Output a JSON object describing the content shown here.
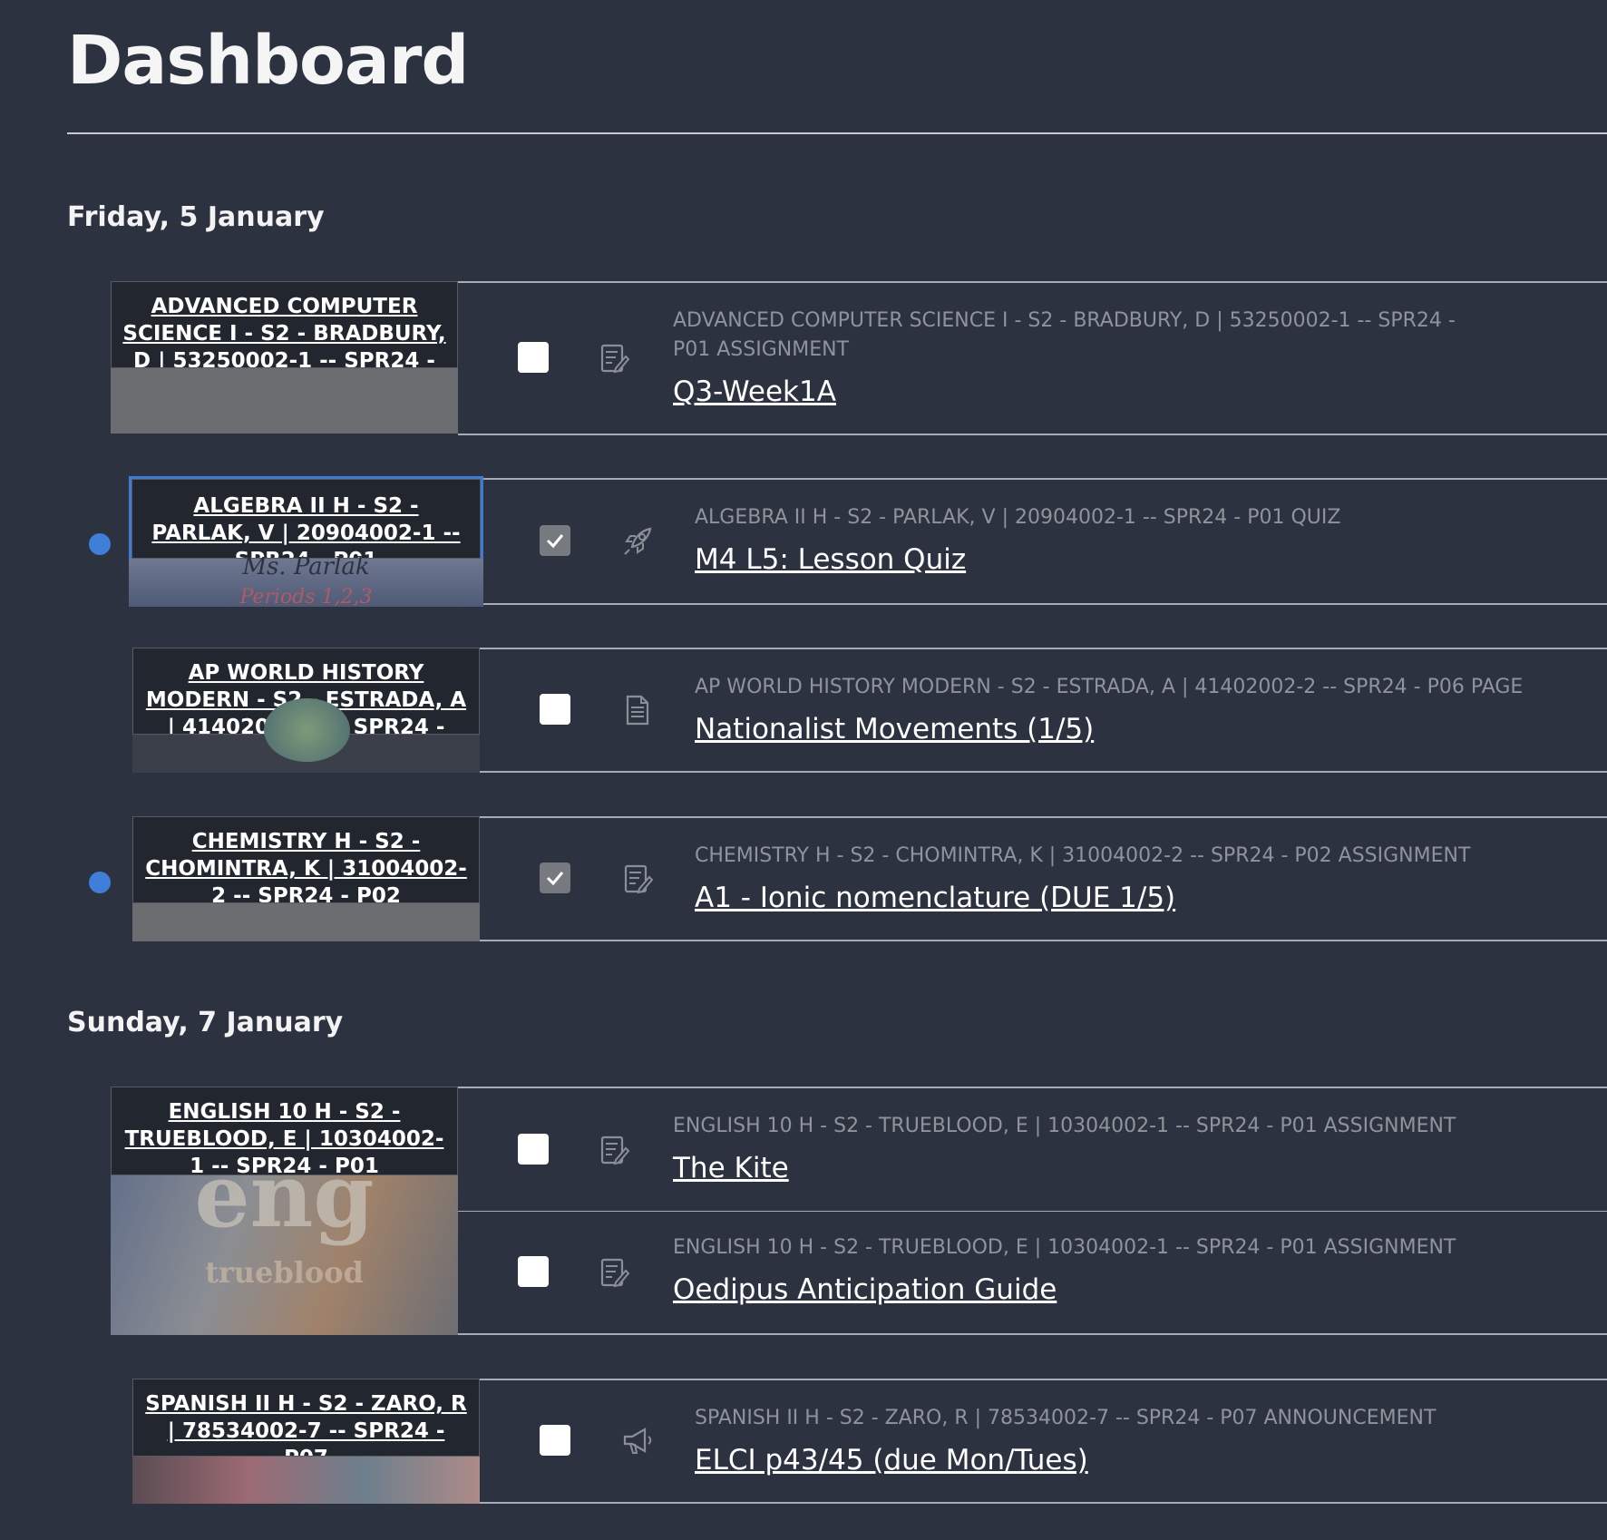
{
  "page": {
    "title": "Dashboard"
  },
  "days": [
    {
      "label": "Friday, 5 January",
      "groups": [
        {
          "course": "ADVANCED COMPUTER SCIENCE I - S2 - BRADBURY, D | 53250002-1 -- SPR24 - P01",
          "items": [
            {
              "meta": "ADVANCED COMPUTER SCIENCE I - S2 - BRADBURY, D | 53250002-1 -- SPR24 - P01 ASSIGNMENT",
              "title": "Q3-Week1A",
              "completed": false,
              "icon": "assignment-icon",
              "new": false
            }
          ]
        },
        {
          "course": "ALGEBRA II H - S2 - PARLAK, V | 20904002-1 -- SPR24 - P01",
          "image_text": [
            "Ms. Parlak",
            "Periods 1,2,3"
          ],
          "items": [
            {
              "meta": "ALGEBRA II H - S2 - PARLAK, V | 20904002-1 -- SPR24 - P01 QUIZ",
              "title": "M4 L5: Lesson Quiz",
              "completed": true,
              "icon": "quiz-rocket-icon",
              "new": true
            }
          ]
        },
        {
          "course": "AP WORLD HISTORY MODERN - S2 - ESTRADA, A | 41402002-2 -- SPR24 - P06",
          "items": [
            {
              "meta": "AP WORLD HISTORY MODERN - S2 - ESTRADA, A | 41402002-2 -- SPR24 - P06 PAGE",
              "title": "Nationalist Movements (1/5)",
              "completed": false,
              "icon": "page-icon",
              "new": false
            }
          ]
        },
        {
          "course": "CHEMISTRY H - S2 - CHOMINTRA, K | 31004002-2 -- SPR24 - P02",
          "items": [
            {
              "meta": "CHEMISTRY H - S2 - CHOMINTRA, K | 31004002-2 -- SPR24 - P02 ASSIGNMENT",
              "title": "A1 - Ionic nomenclature (DUE 1/5)",
              "completed": true,
              "icon": "assignment-icon",
              "new": true
            }
          ]
        }
      ]
    },
    {
      "label": "Sunday, 7 January",
      "groups": [
        {
          "course": "ENGLISH 10 H - S2 - TRUEBLOOD, E | 10304002-1 -- SPR24 - P01",
          "image_text": [
            "eng",
            "trueblood"
          ],
          "items": [
            {
              "meta": "ENGLISH 10 H - S2 - TRUEBLOOD, E | 10304002-1 -- SPR24 - P01 ASSIGNMENT",
              "title": "The Kite",
              "completed": false,
              "icon": "assignment-icon",
              "new": false
            },
            {
              "meta": "ENGLISH 10 H - S2 - TRUEBLOOD, E | 10304002-1 -- SPR24 - P01 ASSIGNMENT",
              "title": "Oedipus Anticipation Guide",
              "completed": false,
              "icon": "assignment-icon",
              "new": false
            }
          ]
        },
        {
          "course": "SPANISH II H - S2 - ZARO, R | 78534002-7 -- SPR24 - P07",
          "items": [
            {
              "meta": "SPANISH II H - S2 - ZARO, R | 78534002-7 -- SPR24 - P07 ANNOUNCEMENT",
              "title": "ELCI p43/45 (due Mon/Tues)",
              "completed": false,
              "icon": "announcement-icon",
              "new": false
            }
          ]
        }
      ]
    }
  ],
  "colors": {
    "background": "#2d3240",
    "new_dot": "#3f7ed9",
    "selection": "#3f7bd6",
    "meta_text": "#8f949b"
  }
}
